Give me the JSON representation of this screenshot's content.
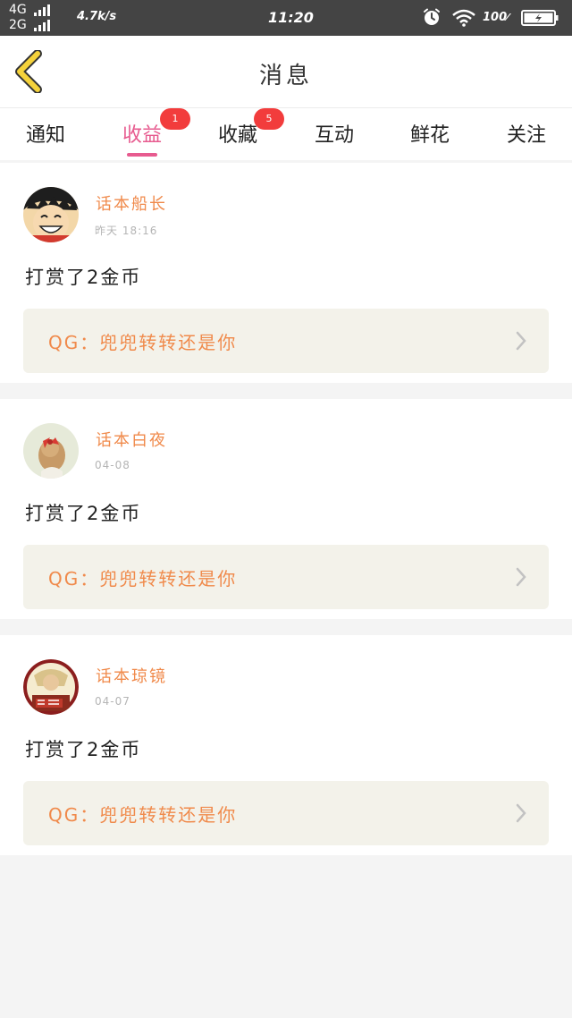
{
  "status_bar": {
    "network_1": "4G",
    "network_2": "2G",
    "speed": "4.7k/s",
    "time": "11:20",
    "battery": "100",
    "icons": [
      "alarm-icon",
      "wifi-icon",
      "battery-charging-icon"
    ]
  },
  "header": {
    "title": "消息",
    "back_icon": "chevron-left-icon"
  },
  "tabs": [
    {
      "label": "通知",
      "badge": null
    },
    {
      "label": "收益",
      "badge": "1",
      "active": true
    },
    {
      "label": "收藏",
      "badge": "5"
    },
    {
      "label": "互动",
      "badge": null
    },
    {
      "label": "鲜花",
      "badge": null
    },
    {
      "label": "关注",
      "badge": null
    }
  ],
  "messages": [
    {
      "username": "话本船长",
      "time": "昨天 18:16",
      "content": "打赏了2金币",
      "quote": "QG：兜兜转转还是你"
    },
    {
      "username": "话本白夜",
      "time": "04-08",
      "content": "打赏了2金币",
      "quote": "QG：兜兜转转还是你"
    },
    {
      "username": "话本琼镜",
      "time": "04-07",
      "content": "打赏了2金币",
      "quote": "QG：兜兜转转还是你"
    }
  ],
  "colors": {
    "accent_pink": "#e75b8f",
    "username_orange": "#f08a4b",
    "badge_red": "#f23c3c",
    "back_arrow_yellow": "#f5d23b"
  }
}
